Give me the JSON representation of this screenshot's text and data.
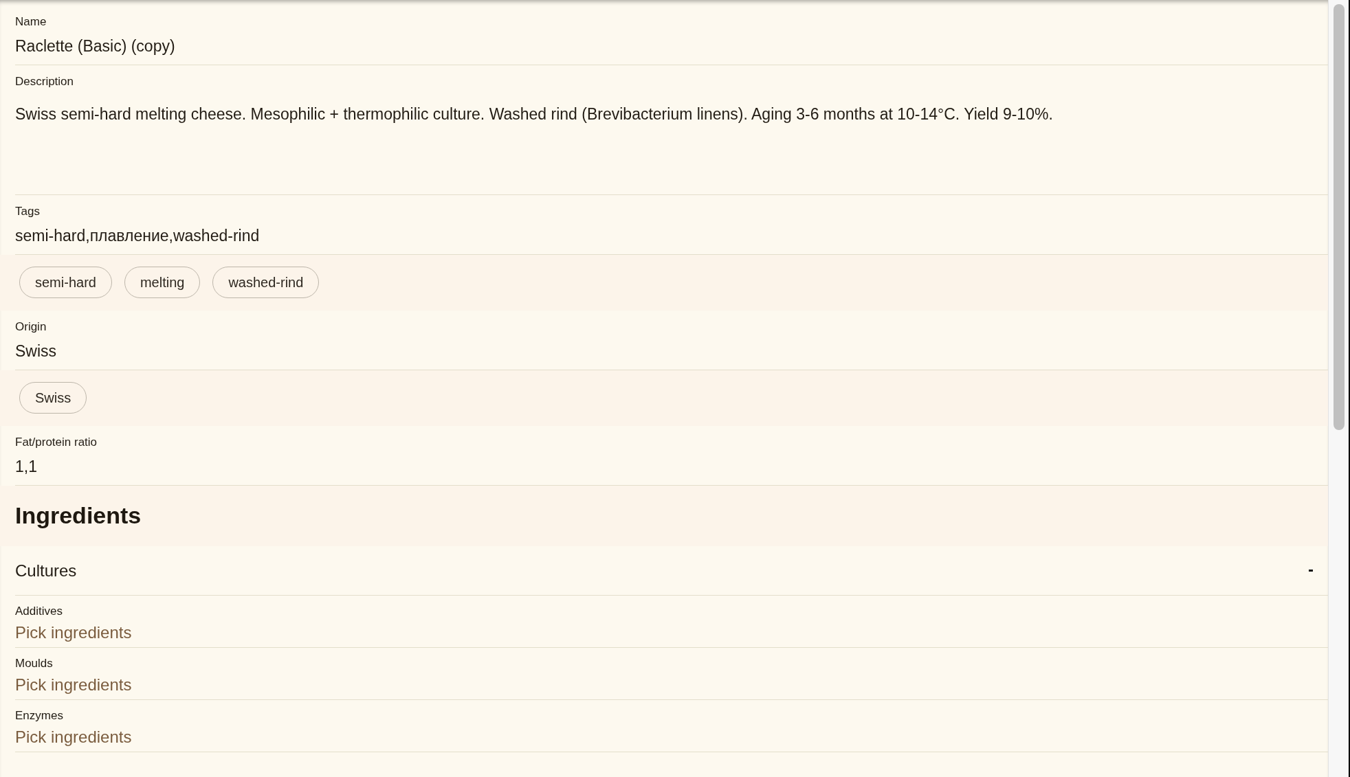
{
  "fields": [
    {
      "kind": "text",
      "label": "Name",
      "value": "Raclette (Basic) (copy)"
    },
    {
      "kind": "textarea",
      "label": "Description",
      "value": "Swiss semi-hard melting cheese. Mesophilic + thermophilic culture. Washed rind (Brevibacterium linens). Aging 3-6 months at 10-14°C. Yield 9-10%."
    },
    {
      "kind": "text",
      "label": "Tags",
      "value": "semi-hard,плавление,washed-rind",
      "chips": [
        "semi-hard",
        "melting",
        "washed-rind"
      ]
    },
    {
      "kind": "text",
      "label": "Origin",
      "value": "Swiss",
      "chips": [
        "Swiss"
      ]
    },
    {
      "kind": "text",
      "label": "Fat/protein ratio",
      "value": "1,1"
    }
  ],
  "ingredients": {
    "title": "Ingredients",
    "groups": [
      {
        "kind": "header",
        "label": "Cultures",
        "expanded": true
      },
      {
        "kind": "picker",
        "label": "Additives",
        "placeholder": "Pick ingredients"
      },
      {
        "kind": "picker",
        "label": "Moulds",
        "placeholder": "Pick ingredients"
      },
      {
        "kind": "picker",
        "label": "Enzymes",
        "placeholder": "Pick ingredients"
      }
    ]
  }
}
